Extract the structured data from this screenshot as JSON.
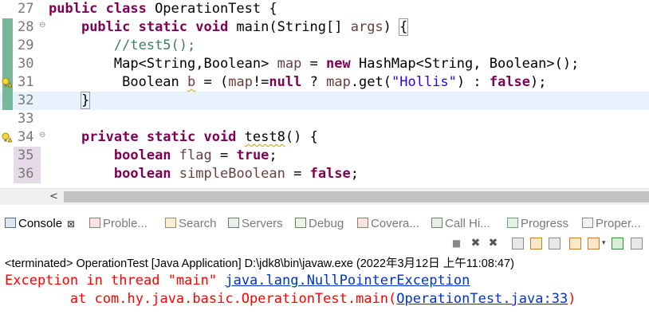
{
  "editor": {
    "lines": [
      {
        "num": "27",
        "fold": "",
        "gutter": "none"
      },
      {
        "num": "28",
        "fold": "⊖",
        "gutter": "green"
      },
      {
        "num": "29",
        "fold": "",
        "gutter": "green"
      },
      {
        "num": "30",
        "fold": "",
        "gutter": "green"
      },
      {
        "num": "31",
        "fold": "",
        "gutter": "green-warning"
      },
      {
        "num": "32",
        "fold": "",
        "gutter": "green",
        "current": true
      },
      {
        "num": "33",
        "fold": "",
        "gutter": "none"
      },
      {
        "num": "34",
        "fold": "⊖",
        "gutter": "warning"
      },
      {
        "num": "35",
        "fold": "",
        "gutter": "pink"
      },
      {
        "num": "36",
        "fold": "",
        "gutter": "pink"
      }
    ],
    "code": {
      "l27": {
        "kw1": "public class",
        "rest": " OperationTest {"
      },
      "l28": {
        "indent": "    ",
        "kw1": "public static void",
        "rest": " main(String[] ",
        "var": "args",
        "close": ") ",
        "brace": "{"
      },
      "l29": {
        "indent": "        ",
        "comment": "//test5();"
      },
      "l30": {
        "indent": "        ",
        "pre": "Map<String,Boolean> ",
        "var": "map",
        "mid": " = ",
        "kw": "new",
        "rest": " HashMap<String, Boolean>();"
      },
      "l31": {
        "indent": "         ",
        "pre": "Boolean ",
        "var": "b",
        "mid": " = (",
        "var2": "map",
        "mid2": "!=",
        "kw": "null",
        "mid3": " ? ",
        "var3": "map",
        "mid4": ".get(",
        "str": "\"Hollis\"",
        "mid5": ") : ",
        "kw2": "false",
        "end": ");"
      },
      "l32": {
        "indent": "    ",
        "rest": "}"
      },
      "l34": {
        "indent": "    ",
        "kw1": "private static void",
        "sp": " ",
        "name": "test8",
        "rest": "() {"
      },
      "l35": {
        "indent": "        ",
        "kw1": "boolean",
        "mid": " ",
        "var": "flag",
        "mid2": " = ",
        "kw2": "true",
        "end": ";"
      },
      "l36": {
        "indent": "        ",
        "kw1": "boolean",
        "mid": " ",
        "var": "simpleBoolean",
        "mid2": " = ",
        "kw2": "false",
        "end": ";"
      }
    }
  },
  "scrollbar": {
    "left_arrow": "<"
  },
  "console_tabs": [
    {
      "label": "Console",
      "active": true,
      "close": "⊠"
    },
    {
      "label": "Proble..."
    },
    {
      "label": "Search"
    },
    {
      "label": "Servers"
    },
    {
      "label": "Debug"
    },
    {
      "label": "Covera..."
    },
    {
      "label": "Call Hi..."
    },
    {
      "label": "Progress"
    },
    {
      "label": "Proper..."
    }
  ],
  "toolbar": {
    "terminate": "■",
    "remove": "✖",
    "remove_all": "✖"
  },
  "console": {
    "status": "<terminated> OperationTest [Java Application] D:\\jdk8\\bin\\javaw.exe (2022年3月12日 上午11:08:47)",
    "line1_prefix": "Exception in thread \"main\" ",
    "line1_link": "java.lang.NullPointerException",
    "line2_prefix": "        at com.hy.java.basic.OperationTest.main(",
    "line2_link": "OperationTest.java:33",
    "line2_suffix": ")"
  }
}
